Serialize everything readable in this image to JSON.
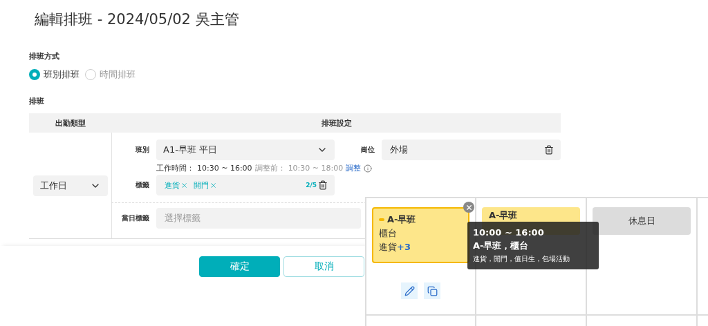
{
  "title": "編輯排班 - 2024/05/02 吳主管",
  "schedule_mode": {
    "label": "排班方式",
    "options": [
      {
        "label": "班別排班",
        "selected": true
      },
      {
        "label": "時間排班",
        "selected": false
      }
    ]
  },
  "schedule": {
    "label": "排班",
    "columns": [
      "出勤類型",
      "排班設定"
    ],
    "attendance_type": "工作日",
    "shift": {
      "label": "班別",
      "value": "A1-早班 平日"
    },
    "post": {
      "label": "崗位",
      "value": "外場"
    },
    "work_time": {
      "label": "工作時間：",
      "value": "10:30 ~ 16:00",
      "before_label": "調整前：",
      "before_value": "10:30 ~ 18:00",
      "link": "調整"
    },
    "tags": {
      "label": "標籤",
      "items": [
        "進貨",
        "開門"
      ],
      "count": "2/5"
    },
    "day_tags": {
      "label": "當日標籤",
      "placeholder": "選擇標籤"
    }
  },
  "buttons": [
    {
      "label": "確定",
      "kind": "primary"
    },
    {
      "label": "取消",
      "kind": "secondary"
    }
  ],
  "calendar": {
    "cards": [
      {
        "kind": "shift",
        "title": "A-早班",
        "post": "櫃台",
        "tag": "進貨",
        "more": "+3",
        "selected": true
      },
      {
        "kind": "shift",
        "title": "A-早班",
        "selected": false
      },
      {
        "kind": "off",
        "title": "休息日",
        "selected": false
      }
    ],
    "tooltip": {
      "time": "10:00 ~ 16:00",
      "summary": "A-早班，櫃台",
      "tags": "進貨，開門，值日生，包場活動"
    }
  }
}
